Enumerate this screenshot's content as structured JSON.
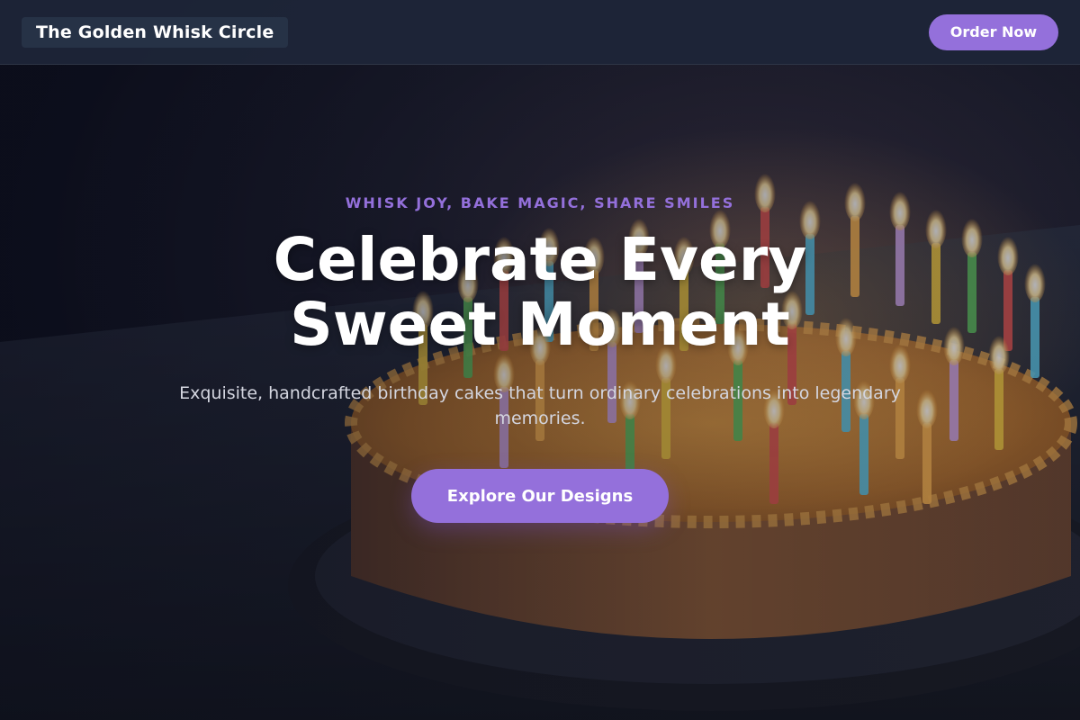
{
  "navbar": {
    "brand": "The Golden Whisk Circle",
    "cta_label": "Order Now"
  },
  "hero": {
    "tagline": "WHISK JOY, BAKE MAGIC, SHARE SMILES",
    "headline_line1": "Celebrate Every",
    "headline_line2": "Sweet Moment",
    "subtitle": "Exquisite, handcrafted birthday cakes that turn ordinary celebrations into legendary memories.",
    "cta_label": "Explore Our Designs",
    "background_image": "birthday-cake-with-lit-candles-photo"
  },
  "colors": {
    "accent": "#9470db",
    "navbar_bg": "#1e2538",
    "page_bg": "#0e1120",
    "headline": "#ffffff",
    "subtitle": "#d4d6e0"
  }
}
